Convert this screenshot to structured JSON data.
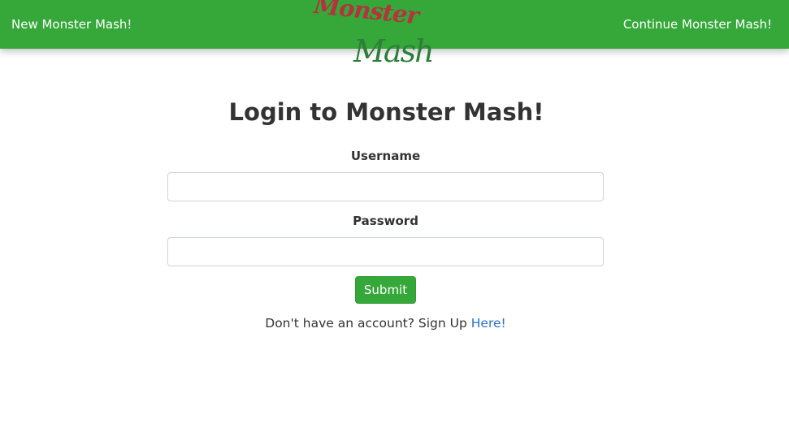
{
  "nav": {
    "left_link": "New Monster Mash!",
    "right_link": "Continue Monster Mash!",
    "logo_text_top": "Monster",
    "logo_text_bottom": "Mash"
  },
  "login": {
    "title": "Login to Monster Mash!",
    "username_label": "Username",
    "username_value": "",
    "password_label": "Password",
    "password_value": "",
    "submit_label": "Submit",
    "signup_prompt": "Don't have an account? Sign Up",
    "signup_link": "Here!"
  },
  "colors": {
    "nav_green": "#35a839",
    "logo_red": "#b5323e",
    "logo_green": "#2e7d3a",
    "link_blue": "#2a73c9"
  }
}
